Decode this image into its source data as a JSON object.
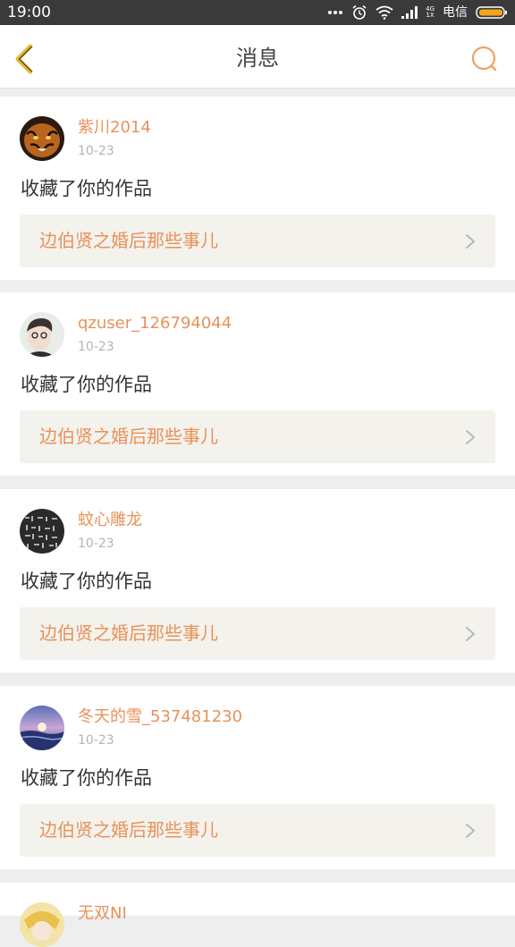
{
  "status_bar": {
    "time": "19:00",
    "network": [
      "4G",
      "1X"
    ],
    "carrier": "电信"
  },
  "header": {
    "title": "消息"
  },
  "colors": {
    "accent": "#e8925a",
    "status_bar_bg": "#3a3a3a",
    "card_link_bg": "#f3f2ec"
  },
  "notifications": [
    {
      "username": "紫川2014",
      "date": "10-23",
      "action": "收藏了你的作品",
      "work_title": "边伯贤之婚后那些事儿"
    },
    {
      "username": "qzuser_126794044",
      "date": "10-23",
      "action": "收藏了你的作品",
      "work_title": "边伯贤之婚后那些事儿"
    },
    {
      "username": "蚊心雕龙",
      "date": "10-23",
      "action": "收藏了你的作品",
      "work_title": "边伯贤之婚后那些事儿"
    },
    {
      "username": "冬天的雪_537481230",
      "date": "10-23",
      "action": "收藏了你的作品",
      "work_title": "边伯贤之婚后那些事儿"
    },
    {
      "username": "无双NI"
    }
  ]
}
